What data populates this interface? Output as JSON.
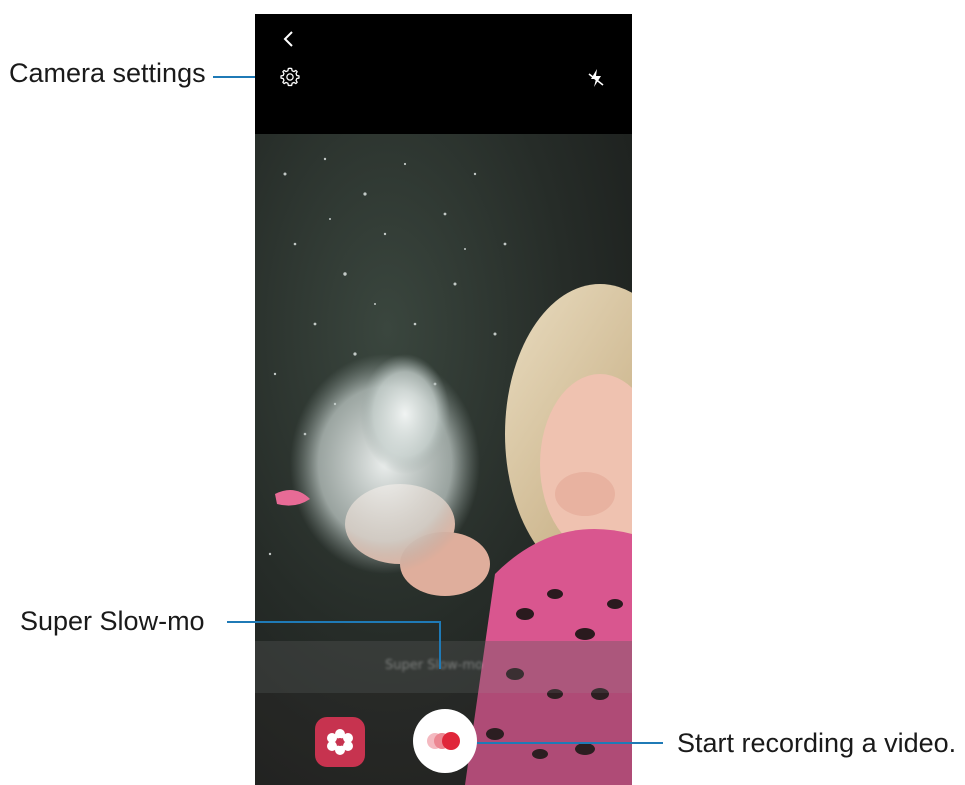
{
  "callouts": {
    "camera_settings": "Camera settings",
    "super_slow_mo": "Super Slow-mo",
    "start_recording": "Start recording a video."
  },
  "camera_ui": {
    "mode_label": "Super Slow-mo",
    "icons": {
      "back": "back-arrow-icon",
      "settings": "gear-icon",
      "flash": "flash-off-icon",
      "gallery": "gallery-flower-icon",
      "record": "record-video-icon"
    }
  },
  "colors": {
    "leader_line": "#1f7ab6",
    "gallery_button": "#c7334f",
    "record_dots": "#e0263a"
  }
}
